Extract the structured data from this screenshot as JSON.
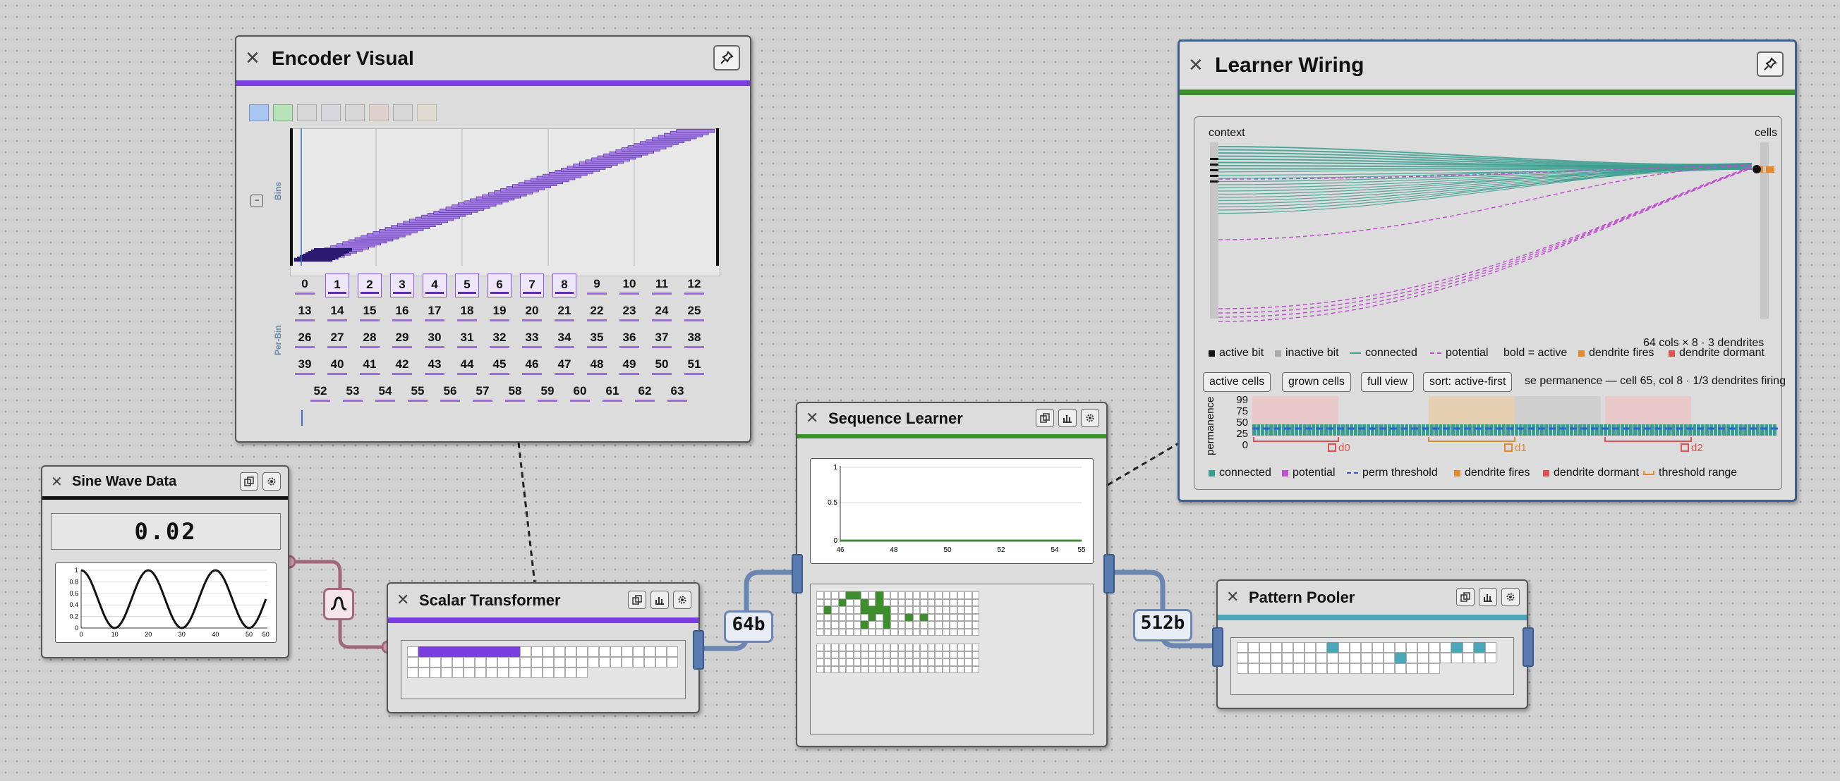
{
  "colors": {
    "purple": "#7b3ee0",
    "purple_light": "#a47ae6",
    "green": "#3f8e2e",
    "teal": "#4aa6b8",
    "dendrite_fires": "#e08a30",
    "dendrite_dormant": "#e05050",
    "connected": "#3a9e8e",
    "potential": "#c050d0",
    "perm_threshold": "#3060e0"
  },
  "encoder_visual": {
    "title": "Encoder Visual",
    "bins_label": "Bins",
    "per_bin_label": "Per-Bin",
    "bins": [
      "0",
      "1",
      "2",
      "3",
      "4",
      "5",
      "6",
      "7",
      "8",
      "9",
      "10",
      "11",
      "12",
      "13",
      "14",
      "15",
      "16",
      "17",
      "18",
      "19",
      "20",
      "21",
      "22",
      "23",
      "24",
      "25",
      "26",
      "27",
      "28",
      "29",
      "30",
      "31",
      "32",
      "33",
      "34",
      "35",
      "36",
      "37",
      "38",
      "39",
      "40",
      "41",
      "42",
      "43",
      "44",
      "45",
      "46",
      "47",
      "48",
      "49",
      "50",
      "51",
      "52",
      "53",
      "54",
      "55",
      "56",
      "57",
      "58",
      "59",
      "60",
      "61",
      "62",
      "63"
    ],
    "highlighted_bins": [
      1,
      2,
      3,
      4,
      5,
      6,
      7,
      8
    ]
  },
  "learner_wiring": {
    "title": "Learner Wiring",
    "context_label": "context",
    "cells_label": "cells",
    "stats": "64 cols × 8 · 3 dendrites",
    "legend1": [
      "active bit",
      "inactive bit",
      "connected",
      "potential",
      "bold = active",
      "dendrite fires",
      "dendrite dormant"
    ],
    "buttons": [
      "active cells",
      "grown cells",
      "full view",
      "sort: active-first"
    ],
    "synapse_label": "se permanence — cell 65, col 8 · 1/3 dendrites firing",
    "ylabel": "permanence",
    "yticks": [
      "99",
      "75",
      "50",
      "25",
      "0"
    ],
    "dendrites": [
      "d0",
      "d1",
      "d2"
    ],
    "legend2": [
      "connected",
      "potential",
      "perm threshold",
      "dendrite fires",
      "dendrite dormant",
      "threshold range"
    ]
  },
  "sine_wave": {
    "title": "Sine Wave Data",
    "value": "0.02",
    "x_ticks": [
      "0",
      "10",
      "20",
      "30",
      "40",
      "50",
      "50"
    ],
    "y_ticks": [
      "1",
      "0.8",
      "0.6",
      "0.4",
      "0.2",
      "0"
    ]
  },
  "scalar_transformer": {
    "title": "Scalar Transformer",
    "active_bits": 9
  },
  "sequence_learner": {
    "title": "Sequence Learner",
    "y_ticks": [
      "1",
      "0.5",
      "0"
    ],
    "x_ticks": [
      "46",
      "48",
      "50",
      "52",
      "54",
      "55"
    ]
  },
  "pattern_pooler": {
    "title": "Pattern Pooler"
  },
  "connections": {
    "badge1": "64b",
    "badge2": "512b"
  },
  "chart_data": [
    {
      "type": "line",
      "name": "sine-wave-mini-plot",
      "x": [
        0,
        5,
        10,
        15,
        20,
        25,
        30,
        35,
        40,
        45,
        50,
        55
      ],
      "y": [
        0.5,
        1,
        0.5,
        0,
        0.5,
        1,
        0.5,
        0,
        0.5,
        1,
        0.5,
        0
      ],
      "xlim": [
        0,
        50
      ],
      "ylim": [
        0,
        1
      ]
    },
    {
      "type": "line",
      "name": "sequence-learner-anomaly-plot",
      "x": [
        46,
        48,
        50,
        52,
        54,
        55
      ],
      "y": [
        0,
        0,
        0,
        0,
        0,
        0
      ],
      "xlim": [
        46,
        55
      ],
      "ylim": [
        0,
        1
      ]
    }
  ]
}
